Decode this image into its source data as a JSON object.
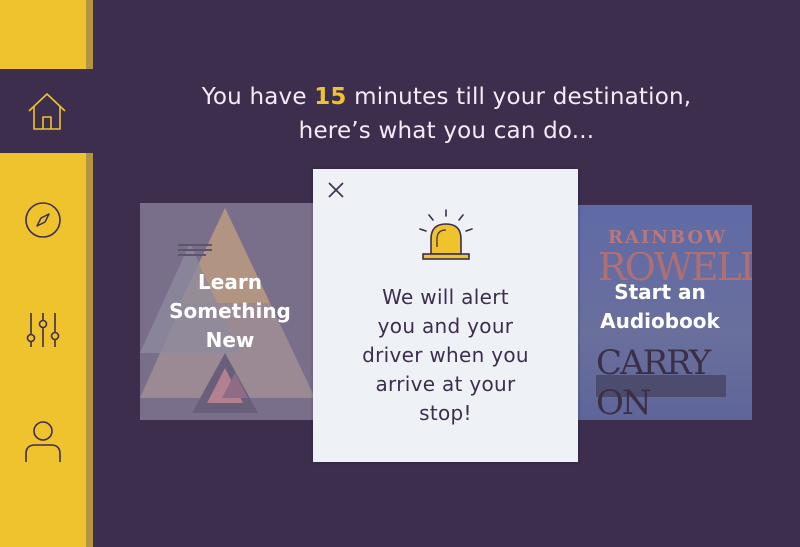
{
  "headline": {
    "prefix": "You have ",
    "minutes": "15",
    "suffix": " minutes till your destination,",
    "line2": "here’s what you can do..."
  },
  "sidebar": {
    "items": [
      {
        "name": "home",
        "icon": "home-icon",
        "active": true
      },
      {
        "name": "explore",
        "icon": "compass-icon",
        "active": false
      },
      {
        "name": "settings",
        "icon": "sliders-icon",
        "active": false
      },
      {
        "name": "profile",
        "icon": "user-icon",
        "active": false
      }
    ]
  },
  "cards": {
    "left": {
      "line1": "Learn",
      "line2": "Something",
      "line3": "New"
    },
    "right": {
      "line1": "Start an",
      "line2": "Audiobook"
    }
  },
  "modal": {
    "line1": "We will alert",
    "line2": "you and your",
    "line3": "driver when you",
    "line4": "arrive at your",
    "line5": "stop!"
  },
  "book": {
    "author_top": "RAINBOW",
    "author_bottom": "ROWELL",
    "title": "CARRY ON"
  },
  "colors": {
    "background": "#3d2e4e",
    "accent": "#eec32d",
    "modal_bg": "#eef1f5"
  }
}
